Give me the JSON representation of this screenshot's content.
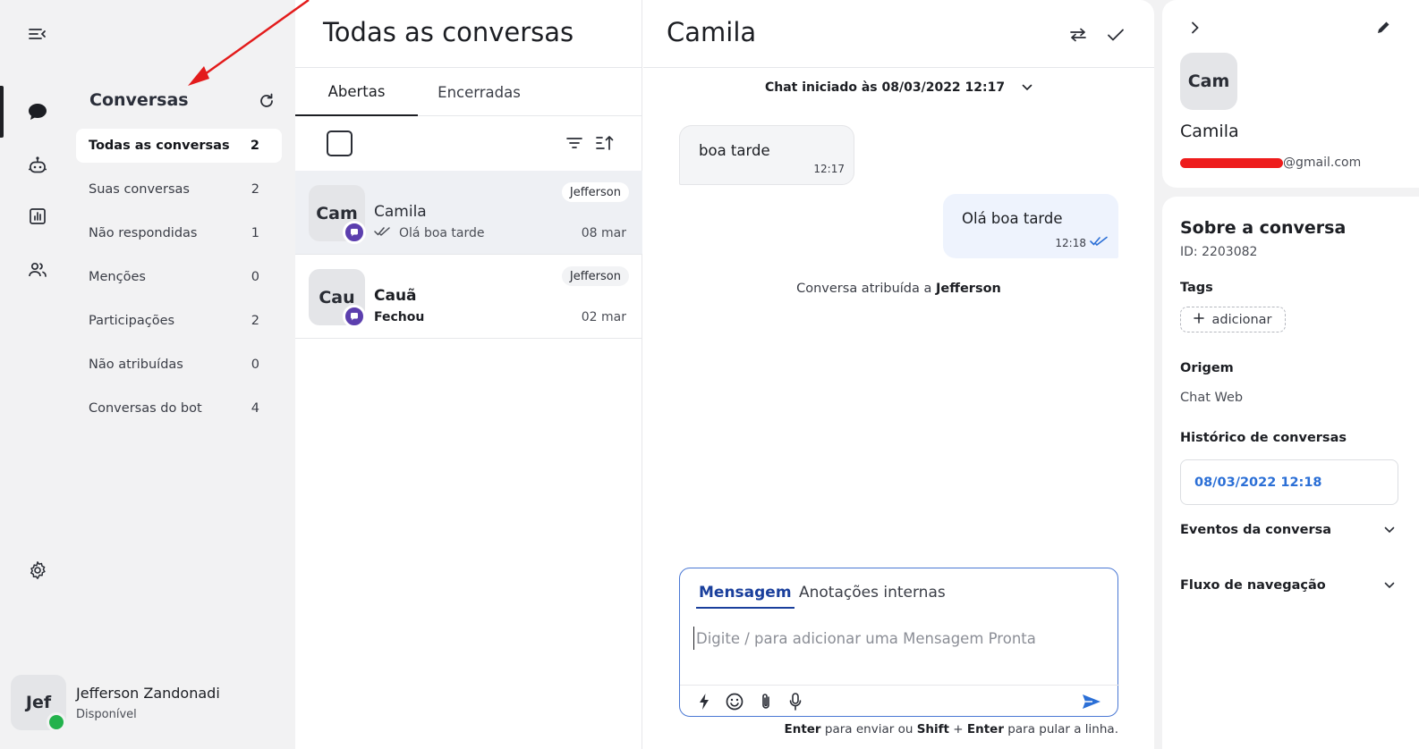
{
  "rail": {
    "icons": [
      "collapse-menu-icon",
      "chat-bubble-icon",
      "bot-icon",
      "reports-icon",
      "contacts-icon",
      "settings-icon"
    ]
  },
  "sidebar": {
    "title": "Conversas",
    "items": [
      {
        "label": "Todas as conversas",
        "count": "2"
      },
      {
        "label": "Suas conversas",
        "count": "2"
      },
      {
        "label": "Não respondidas",
        "count": "1"
      },
      {
        "label": "Menções",
        "count": "0"
      },
      {
        "label": "Participações",
        "count": "2"
      },
      {
        "label": "Não atribuídas",
        "count": "0"
      },
      {
        "label": "Conversas do bot",
        "count": "4"
      }
    ]
  },
  "user": {
    "initials": "Jef",
    "name": "Jefferson Zandonadi",
    "status": "Disponível"
  },
  "list": {
    "title": "Todas as conversas",
    "tabs": [
      "Abertas",
      "Encerradas"
    ],
    "conversations": [
      {
        "initials": "Cam",
        "name": "Camila",
        "preview": "Olá boa tarde",
        "date": "08 mar",
        "agent": "Jefferson"
      },
      {
        "initials": "Cau",
        "name": "Cauã",
        "preview": "Fechou",
        "date": "02 mar",
        "agent": "Jefferson"
      }
    ]
  },
  "chat": {
    "title": "Camila",
    "started": "Chat iniciado às 08/03/2022 12:17",
    "messages": [
      {
        "direction": "in",
        "text": "boa tarde",
        "time": "12:17"
      },
      {
        "direction": "out",
        "text": "Olá boa tarde",
        "time": "12:18"
      }
    ],
    "assigned_prefix": "Conversa atribuída a",
    "assigned_name": "Jefferson",
    "composer": {
      "tabs": [
        "Mensagem",
        "Anotações internas"
      ],
      "placeholder": "Digite / para adicionar uma Mensagem Pronta"
    },
    "hint": {
      "enter": "Enter",
      "send_text": "para enviar ou",
      "shift": "Shift",
      "plus": "+",
      "enter2": "Enter",
      "newline_text": "para pular a linha."
    }
  },
  "contact": {
    "initials": "Cam",
    "name": "Camila",
    "email_visible": "@gmail.com"
  },
  "about": {
    "title": "Sobre a conversa",
    "id": "ID: 2203082",
    "tags_label": "Tags",
    "add_tag": "adicionar",
    "origin_label": "Origem",
    "origin_value": "Chat Web",
    "history_label": "Histórico de conversas",
    "history_item": "08/03/2022 12:18",
    "events_label": "Eventos da conversa",
    "flow_label": "Fluxo de navegação"
  },
  "colors": {
    "accent_blue": "#2b6fd6",
    "channel_purple": "#5c3fae",
    "online_green": "#22b24c",
    "annotation_red": "#e31b1b"
  }
}
